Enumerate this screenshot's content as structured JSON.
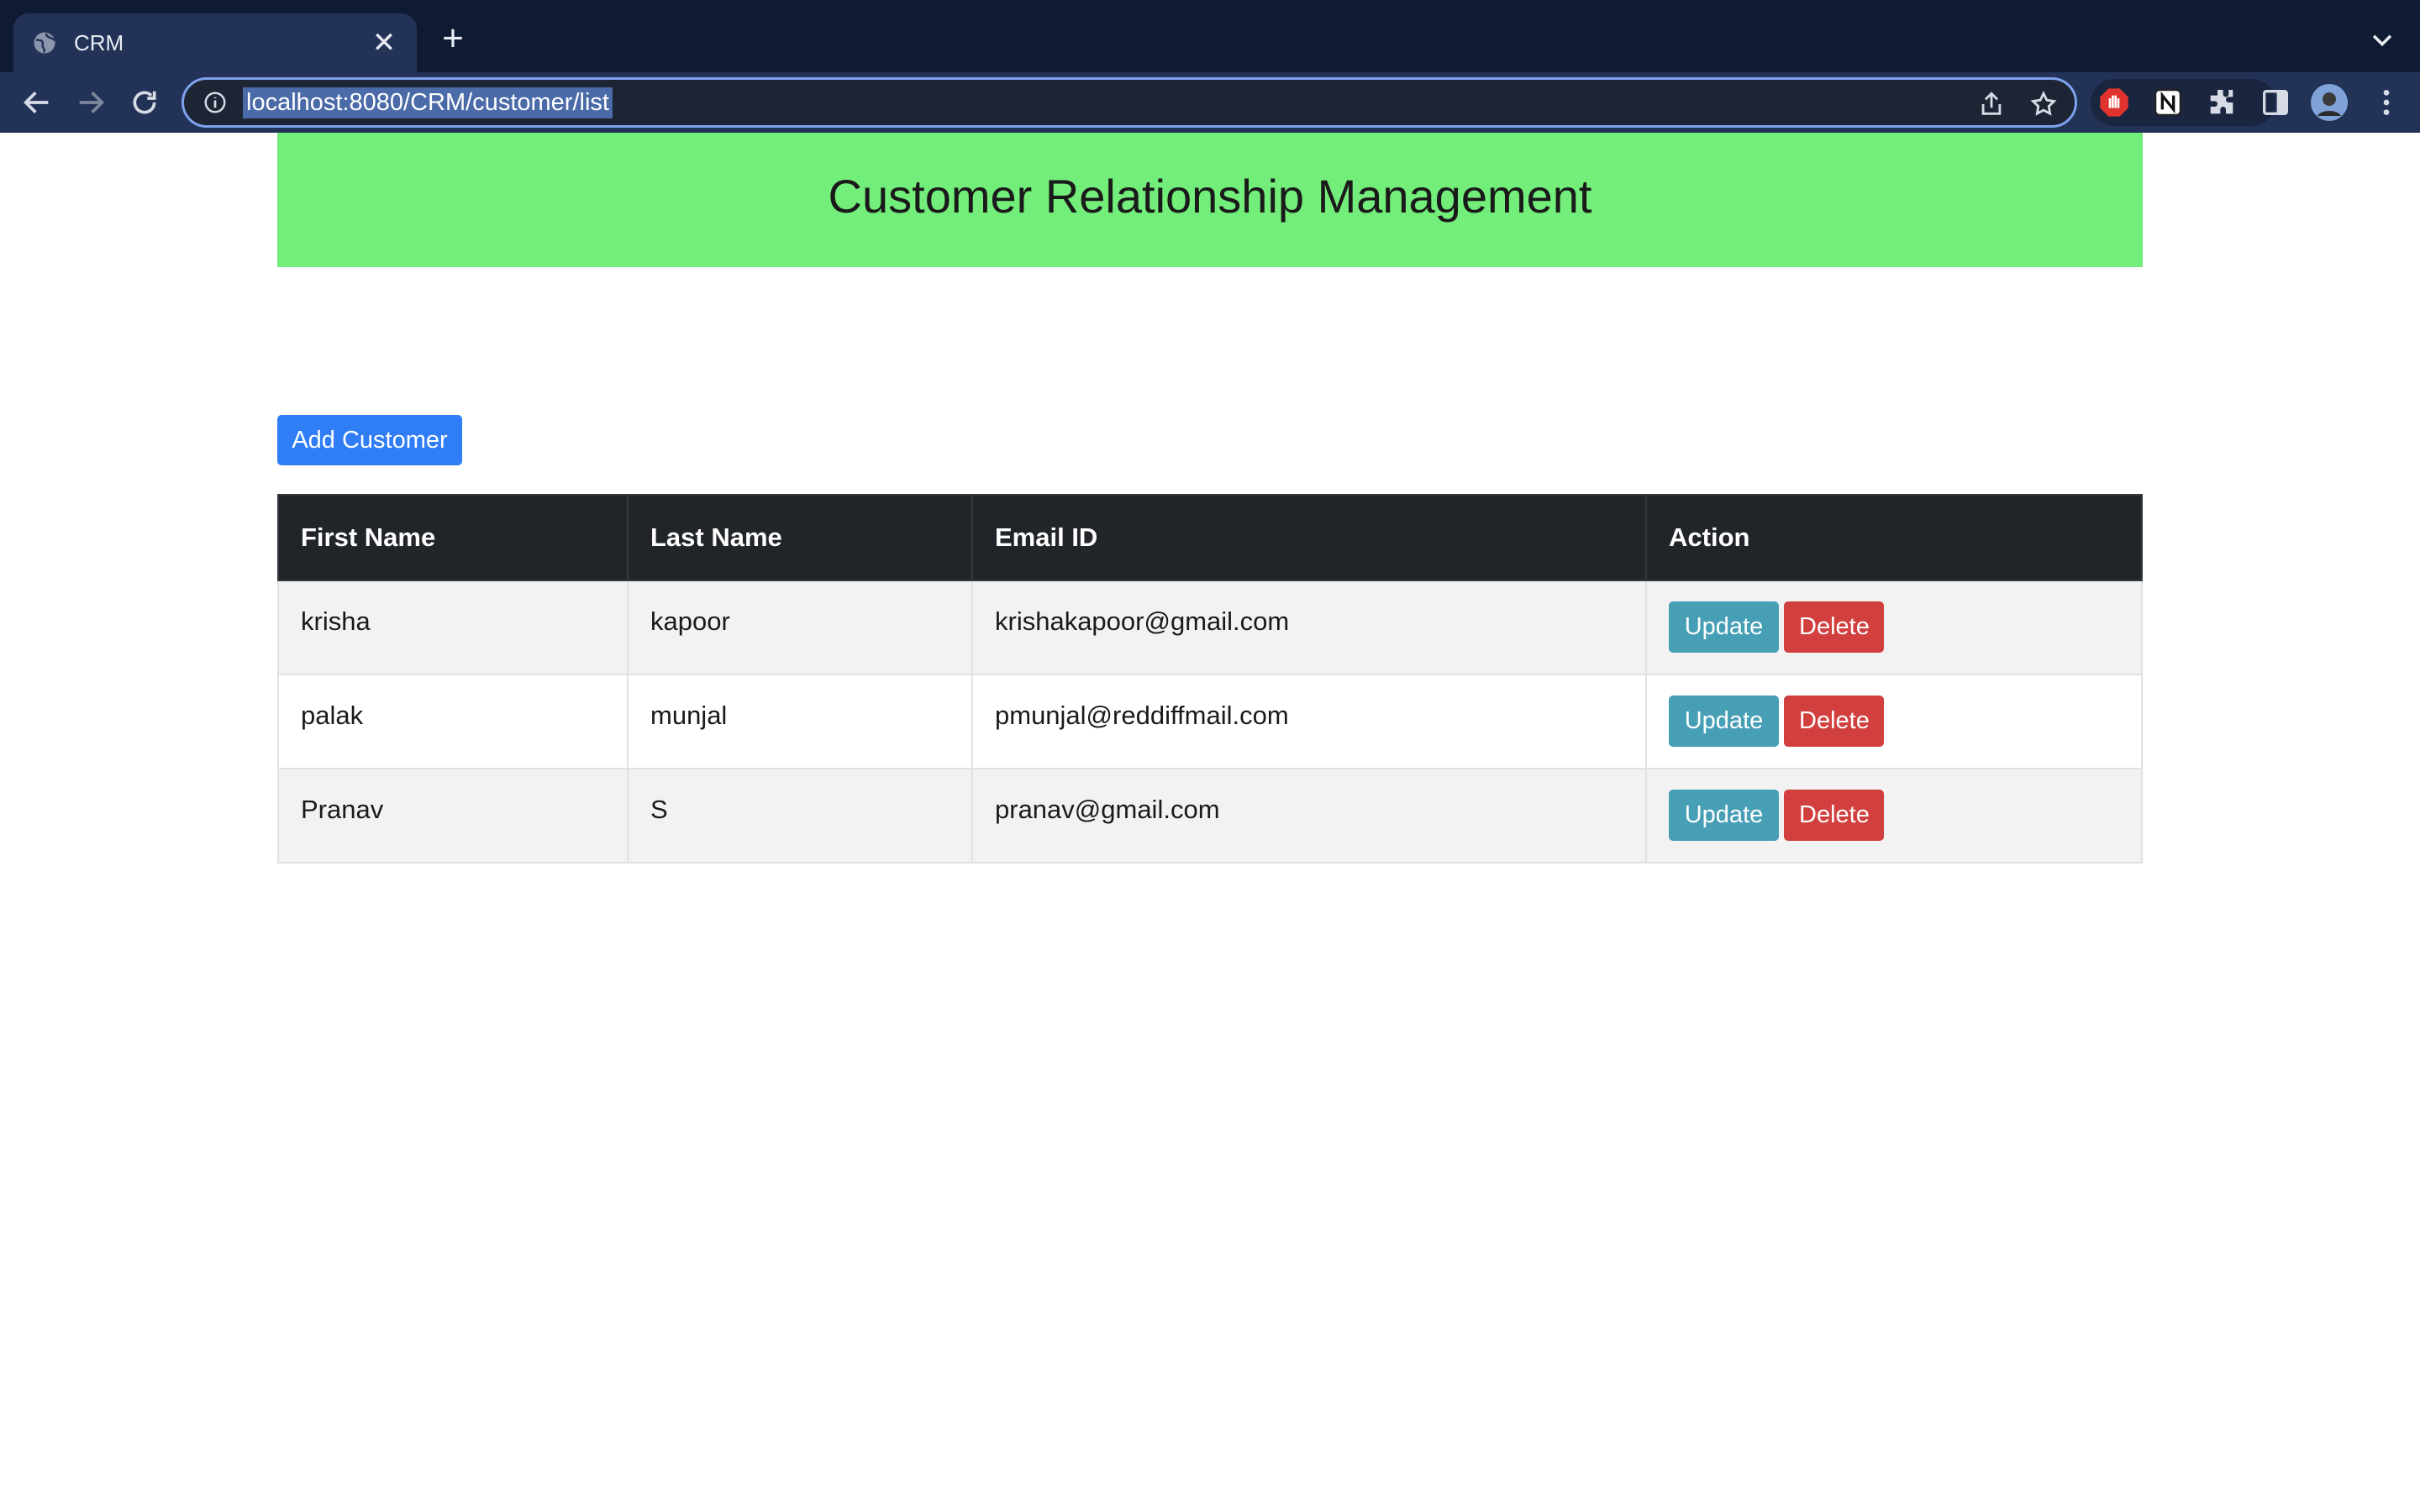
{
  "browser": {
    "tab_title": "CRM",
    "url": "localhost:8080/CRM/customer/list"
  },
  "page": {
    "title": "Customer Relationship Management",
    "add_button_label": "Add Customer"
  },
  "table": {
    "headers": [
      "First Name",
      "Last Name",
      "Email ID",
      "Action"
    ],
    "rows": [
      {
        "first_name": "krisha",
        "last_name": "kapoor",
        "email": "krishakapoor@gmail.com"
      },
      {
        "first_name": "palak",
        "last_name": "munjal",
        "email": "pmunjal@reddiffmail.com"
      },
      {
        "first_name": "Pranav",
        "last_name": "S",
        "email": "pranav@gmail.com"
      }
    ],
    "update_label": "Update",
    "delete_label": "Delete"
  },
  "colors": {
    "header_bg": "#73ee7a",
    "primary": "#2f7ef6",
    "update": "#479fb6",
    "delete": "#d1403f",
    "table_head": "#212529"
  }
}
